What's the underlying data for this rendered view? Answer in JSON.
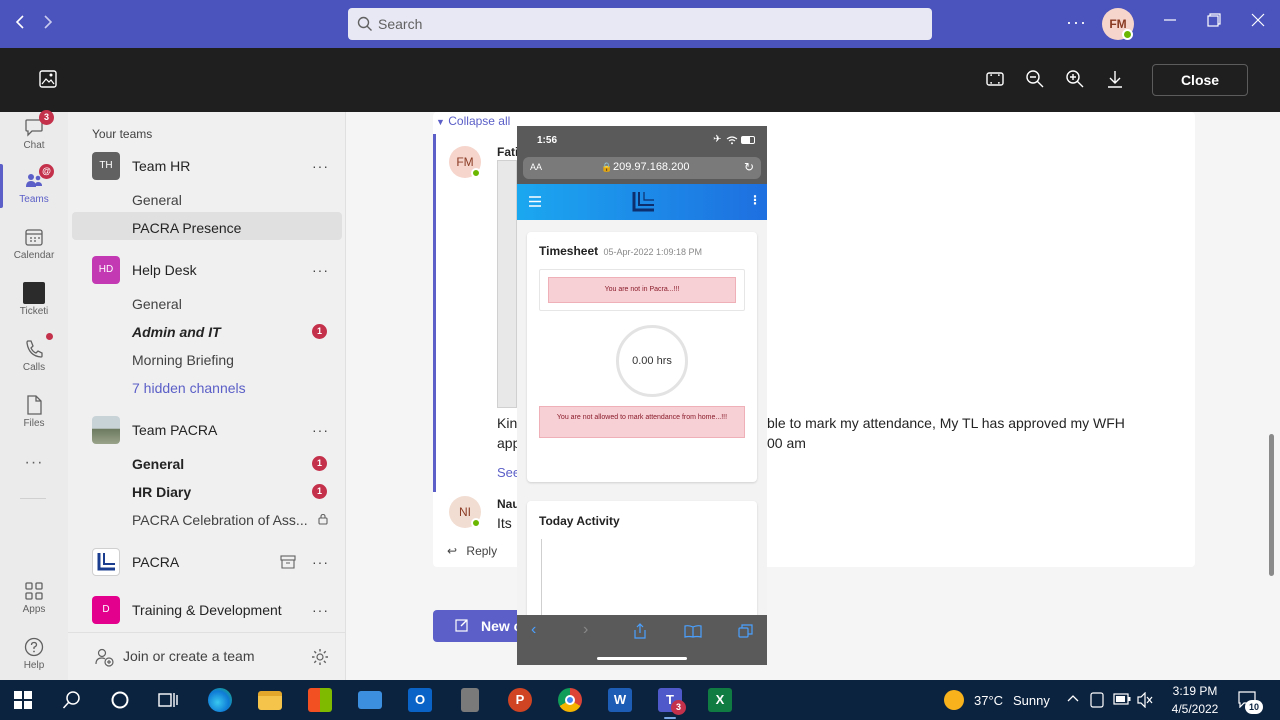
{
  "titlebar": {
    "search_placeholder": "Search",
    "avatar_initials": "FM",
    "more": "···"
  },
  "viewer": {
    "close_label": "Close"
  },
  "rail": {
    "chat": "Chat",
    "chat_badge": "3",
    "teams": "Teams",
    "teams_badge": "@",
    "calendar": "Calendar",
    "ticket": "Ticketi",
    "calls": "Calls",
    "files": "Files",
    "more": "···",
    "apps": "Apps",
    "help": "Help"
  },
  "teams_panel": {
    "heading": "Your teams",
    "teams": [
      {
        "initials": "TH",
        "name": "Team HR",
        "color": "#616161"
      },
      {
        "initials": "HD",
        "name": "Help Desk",
        "color": "#c239b3"
      },
      {
        "initials": "",
        "name": "Team PACRA",
        "color": "#8a9aa0"
      },
      {
        "initials": "",
        "name": "PACRA",
        "color": "#ffffff"
      },
      {
        "initials": "D",
        "name": "Training & Development",
        "color": "#e3008c"
      }
    ],
    "channels": {
      "hr_general": "General",
      "hr_presence": "PACRA Presence",
      "hd_general": "General",
      "hd_admin": "Admin and IT",
      "hd_admin_badge": "1",
      "hd_briefing": "Morning Briefing",
      "hd_hidden": "7 hidden channels",
      "tp_general": "General",
      "tp_general_badge": "1",
      "tp_diary": "HR Diary",
      "tp_diary_badge": "1",
      "tp_celebration": "PACRA Celebration of Ass..."
    },
    "join_label": "Join or create a team",
    "more_dots": "···"
  },
  "chat": {
    "collapse_all": "Collapse all",
    "msg1_avatar": "FM",
    "msg1_name": "Fati",
    "msg1_text_line1": "Kin",
    "msg1_text_right1": "ble to mark my attendance, My TL has approved my WFH",
    "msg1_text_line2": "app",
    "msg1_text_right2": "00 am",
    "see_more": "See",
    "msg2_avatar": "NI",
    "msg2_name": "Nau",
    "msg2_text": "Its",
    "reply": "Reply",
    "new_conversation": "New c"
  },
  "phone": {
    "time": "1:56",
    "aa": "AA",
    "url": "209.97.168.200",
    "timesheet_title": "Timesheet",
    "timesheet_date": "05-Apr-2022 1:09:18 PM",
    "alert_not_in": "You are not in Pacra...!!!",
    "hours": "0.00 hrs",
    "alert_home": "You are not allowed to mark attendance from home...!!!",
    "today_activity": "Today Activity"
  },
  "taskbar": {
    "temperature": "37°C",
    "weather": "Sunny",
    "time": "3:19 PM",
    "date": "4/5/2022",
    "notif_count": "10",
    "teams_badge": "3",
    "ppt_letter": "P",
    "outlook_letter": "O",
    "word_letter": "W",
    "teams_letter": "T",
    "excel_letter": "X"
  },
  "colors": {
    "brand": "#4b53bc",
    "accent": "#5b5fc7",
    "alert": "#c4314b",
    "taskbar": "#0c2340"
  }
}
